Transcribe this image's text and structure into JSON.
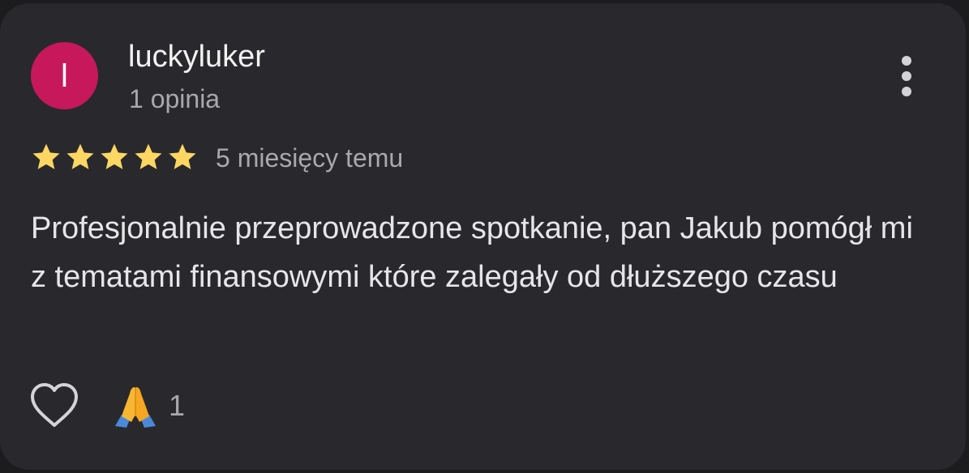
{
  "reviewer": {
    "avatar_letter": "l",
    "avatar_color": "#c6185a",
    "username": "luckyluker",
    "review_count": "1 opinia"
  },
  "rating": {
    "stars": 5,
    "max_stars": 5,
    "star_color": "#fdd663",
    "date": "5 miesięcy temu"
  },
  "review": {
    "text": "Profesjonalnie przeprowadzone spotkanie, pan Jakub pomógł mi z tematami finansowymi które zalegały od dłuższego czasu"
  },
  "actions": {
    "menu_icon": "more-vert-icon",
    "like_icon": "heart-outline-icon",
    "reaction_icon": "folded-hands-icon",
    "reaction_count": "1"
  }
}
